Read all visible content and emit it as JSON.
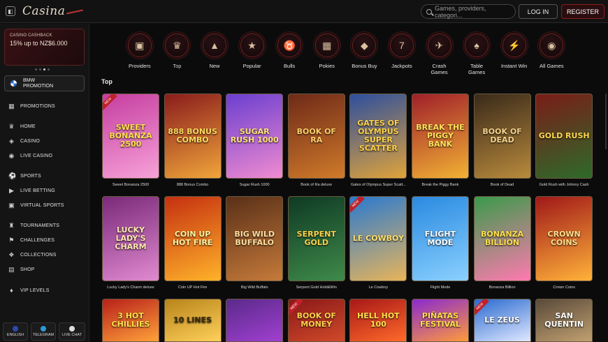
{
  "header": {
    "logo": "Casina",
    "search_placeholder": "Games, providers, categori...",
    "login": "LOG IN",
    "register": "REGISTER"
  },
  "sidebar": {
    "promo": {
      "small": "CASINO CASHBACK",
      "big": "15% up to NZ$6.000"
    },
    "bmw": {
      "line1": "BMW",
      "line2": "PROMOTION"
    },
    "items": [
      {
        "label": "PROMOTIONS",
        "icon": "gift-icon"
      },
      {
        "label": "HOME",
        "icon": "crown-icon"
      },
      {
        "label": "CASINO",
        "icon": "casino-icon"
      },
      {
        "label": "LIVE CASINO",
        "icon": "live-icon"
      },
      {
        "label": "SPORTS",
        "icon": "ball-icon"
      },
      {
        "label": "LIVE BETTING",
        "icon": "live-betting-icon"
      },
      {
        "label": "VIRTUAL SPORTS",
        "icon": "virtual-icon"
      },
      {
        "label": "TOURNAMENTS",
        "icon": "tournament-icon"
      },
      {
        "label": "CHALLENGES",
        "icon": "challenge-icon"
      },
      {
        "label": "COLLECTIONS",
        "icon": "collection-icon"
      },
      {
        "label": "SHOP",
        "icon": "shop-icon"
      },
      {
        "label": "VIP LEVELS",
        "icon": "vip-icon"
      }
    ],
    "bottom": {
      "english": "ENGLISH",
      "telegram": "TELEGRAM",
      "livechat": "LIVE CHAT"
    }
  },
  "categories": [
    {
      "label": "Providers",
      "glyph": "▣"
    },
    {
      "label": "Top",
      "glyph": "♛"
    },
    {
      "label": "New",
      "glyph": "▲"
    },
    {
      "label": "Popular",
      "glyph": "★"
    },
    {
      "label": "Bulls",
      "glyph": "♉"
    },
    {
      "label": "Pokies",
      "glyph": "▦"
    },
    {
      "label": "Bonus Buy",
      "glyph": "◆"
    },
    {
      "label": "Jackpots",
      "glyph": "7"
    },
    {
      "label": "Crash\nGames",
      "glyph": "✈"
    },
    {
      "label": "Table\nGames",
      "glyph": "♠"
    },
    {
      "label": "Instant Win",
      "glyph": "⚡"
    },
    {
      "label": "All Games",
      "glyph": "◉"
    }
  ],
  "section_title": "Top",
  "games": [
    {
      "name": "Sweet Bonanza 2500",
      "title": "SWEET BONANZA 2500",
      "bg": "#c53ea0",
      "bg2": "#f7a1d8",
      "fg": "#ffe14a",
      "new": true
    },
    {
      "name": "888 Bonus Combo",
      "title": "888 BONUS COMBO",
      "bg": "#8a1c1c",
      "bg2": "#f0a53a",
      "fg": "#ffd95e",
      "new": false
    },
    {
      "name": "Sugar Rush 1000",
      "title": "SUGAR RUSH 1000",
      "bg": "#6b3fd0",
      "bg2": "#f08bd0",
      "fg": "#ffe37a",
      "new": false
    },
    {
      "name": "Book of Ra deluxe",
      "title": "BOOK OF RA",
      "bg": "#6e2a18",
      "bg2": "#d07a2a",
      "fg": "#ffcf6a",
      "new": false
    },
    {
      "name": "Gates of Olympus Super Scatt...",
      "title": "GATES OF OLYMPUS SUPER SCATTER",
      "bg": "#2d4f9e",
      "bg2": "#e0a33a",
      "fg": "#ffd24a",
      "new": false
    },
    {
      "name": "Break the Piggy Bank",
      "title": "BREAK THE PIGGY BANK",
      "bg": "#a01f2a",
      "bg2": "#f2b234",
      "fg": "#ffe35a",
      "new": false
    },
    {
      "name": "Book of Dead",
      "title": "BOOK OF DEAD",
      "bg": "#3a2a1a",
      "bg2": "#b88a3c",
      "fg": "#f3d38a",
      "new": false
    },
    {
      "name": "Gold Rush with Johnny Cash",
      "title": "GOLD RUSH",
      "bg": "#7a1d18",
      "bg2": "#2d6a2a",
      "fg": "#ffd84a",
      "new": false
    },
    {
      "name": "Lucky Lady's Charm deluxe",
      "title": "LUCKY LADY'S CHARM",
      "bg": "#7a2a7a",
      "bg2": "#e08ad0",
      "fg": "#ffe8b0",
      "new": false
    },
    {
      "name": "Coin UP Hot Fire",
      "title": "COIN UP HOT FIRE",
      "bg": "#c53010",
      "bg2": "#ffb22a",
      "fg": "#fff2a0",
      "new": false
    },
    {
      "name": "Big Wild Buffalo",
      "title": "BIG WILD BUFFALO",
      "bg": "#5a3018",
      "bg2": "#c57a3a",
      "fg": "#ffe0a0",
      "new": false
    },
    {
      "name": "Serpent Gold Hold&Win",
      "title": "SERPENT GOLD",
      "bg": "#0f3a24",
      "bg2": "#3f8a4a",
      "fg": "#ffd24a",
      "new": false
    },
    {
      "name": "Le Cowboy",
      "title": "LE COWBOY",
      "bg": "#2a7ad0",
      "bg2": "#e8b45a",
      "fg": "#ffe070",
      "new": true
    },
    {
      "name": "Flight Mode",
      "title": "FLIGHT MODE",
      "bg": "#2a8ae0",
      "bg2": "#8ad0ff",
      "fg": "#ffffff",
      "new": false
    },
    {
      "name": "Bonanza Billion",
      "title": "BONANZA BILLION",
      "bg": "#3a9a4a",
      "bg2": "#ff7ab0",
      "fg": "#ffe04a",
      "new": false
    },
    {
      "name": "Crown Coins",
      "title": "CROWN COINS",
      "bg": "#a01818",
      "bg2": "#ffb23a",
      "fg": "#ffe08a",
      "new": false
    },
    {
      "name": "",
      "title": "3 HOT CHILLIES",
      "bg": "#b8201a",
      "bg2": "#ffa23a",
      "fg": "#ffe04a",
      "new": false
    },
    {
      "name": "",
      "title": "10 LINES",
      "bg": "#b8841a",
      "bg2": "#ffd05a",
      "fg": "#3a2a0a",
      "new": false
    },
    {
      "name": "",
      "title": "",
      "bg": "#5a2a8a",
      "bg2": "#a040d0",
      "fg": "#ffe04a",
      "new": false
    },
    {
      "name": "",
      "title": "BOOK OF MONEY",
      "bg": "#8a1818",
      "bg2": "#d04a2a",
      "fg": "#ffd24a",
      "new": true
    },
    {
      "name": "",
      "title": "HELL HOT 100",
      "bg": "#a81818",
      "bg2": "#ff6a2a",
      "fg": "#ffe04a",
      "new": false
    },
    {
      "name": "",
      "title": "PIÑATAS FESTIVAL",
      "bg": "#8a2ad0",
      "bg2": "#ff9a3a",
      "fg": "#ffe04a",
      "new": false
    },
    {
      "name": "",
      "title": "LE ZEUS",
      "bg": "#2a6ad0",
      "bg2": "#e0e8ff",
      "fg": "#ffffff",
      "new": true
    },
    {
      "name": "",
      "title": "SAN QUENTIN",
      "bg": "#5a4a3a",
      "bg2": "#c0a070",
      "fg": "#ffffff",
      "new": false
    }
  ]
}
